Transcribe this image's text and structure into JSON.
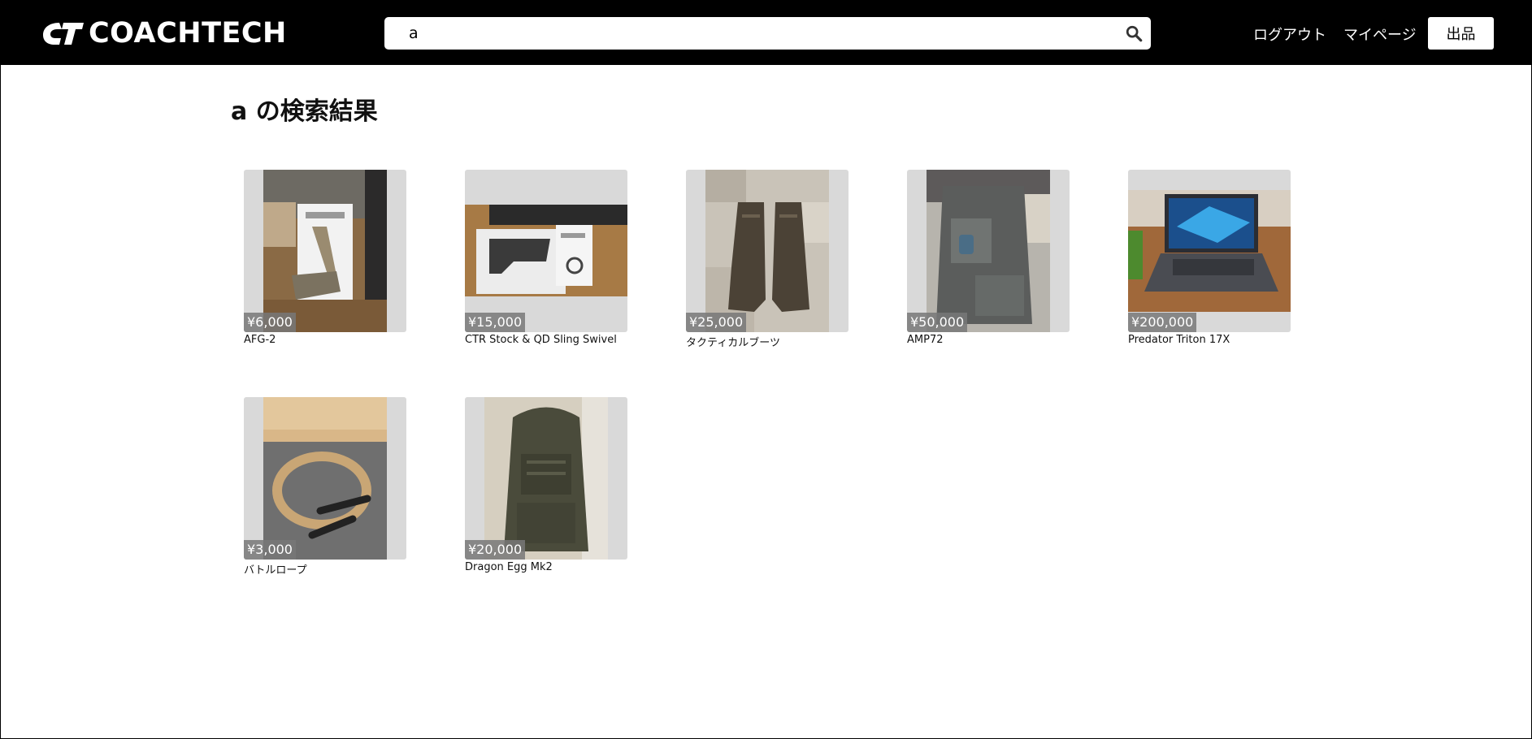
{
  "header": {
    "logo_text": "COACHTECH",
    "search": {
      "value": "a",
      "placeholder": ""
    },
    "logout_label": "ログアウト",
    "mypage_label": "マイページ",
    "sell_label": "出品"
  },
  "results": {
    "title": "a の検索結果",
    "items": [
      {
        "name": "AFG-2",
        "price": "¥6,000"
      },
      {
        "name": "CTR Stock & QD Sling Swivel",
        "price": "¥15,000"
      },
      {
        "name": "タクティカルブーツ",
        "price": "¥25,000"
      },
      {
        "name": "AMP72",
        "price": "¥50,000"
      },
      {
        "name": "Predator Triton 17X",
        "price": "¥200,000"
      },
      {
        "name": "バトルロープ",
        "price": "¥3,000"
      },
      {
        "name": "Dragon Egg Mk2",
        "price": "¥20,000"
      }
    ]
  },
  "colors": {
    "header_bg": "#000000",
    "thumb_bg": "#d9d9d9",
    "price_bg": "#787878"
  },
  "icons": [
    "search-icon"
  ]
}
